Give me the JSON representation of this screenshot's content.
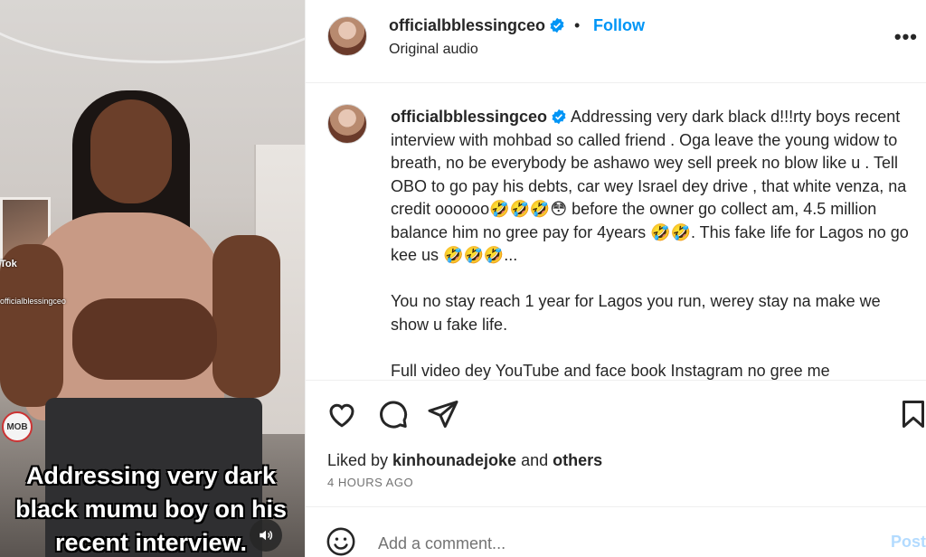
{
  "video": {
    "caption": "Addressing very dark\nblack mumu boy on his\nrecent interview.",
    "watermark_brand": "Tok",
    "watermark_handle": "officialblessingceo",
    "poster_text": "MOB"
  },
  "post": {
    "username": "officialbblessingceo",
    "separator": "•",
    "follow_label": "Follow",
    "audio": "Original audio",
    "more_label": "•••"
  },
  "comment": {
    "username": "officialbblessingceo",
    "text": " Addressing very dark black d!!!rty boys recent interview with mohbad so called friend . Oga leave the young widow to breath, no be everybody be ashawo wey sell preek no blow like u . Tell OBO to go pay his debts, car wey Israel dey drive , that white venza, na credit oooooo🤣🤣🤣😳 before the owner go collect am, 4.5 million balance him no gree pay for 4years 🤣🤣. This fake life for Lagos no go kee us 🤣🤣🤣...\n\nYou no stay reach 1 year for Lagos you run, werey stay na make we show u fake life.\n\nFull video dey YouTube and face book Instagram no gree me"
  },
  "engagement": {
    "liked_prefix": "Liked by ",
    "liked_user": "kinhounadejoke",
    "liked_mid": " and ",
    "liked_others": "others",
    "timestamp": "4 HOURS AGO"
  },
  "composer": {
    "placeholder": "Add a comment...",
    "post_label": "Post"
  },
  "icons": {
    "like": "heart-icon",
    "comment": "comment-icon",
    "share": "send-icon",
    "save": "bookmark-icon",
    "emoji": "smiley-icon",
    "mute": "speaker-icon",
    "verified": "verified-badge-icon"
  },
  "colors": {
    "accent": "#0095f6",
    "verified": "#0095f6",
    "post_disabled": "#b3dbff",
    "muted_text": "#737373"
  }
}
